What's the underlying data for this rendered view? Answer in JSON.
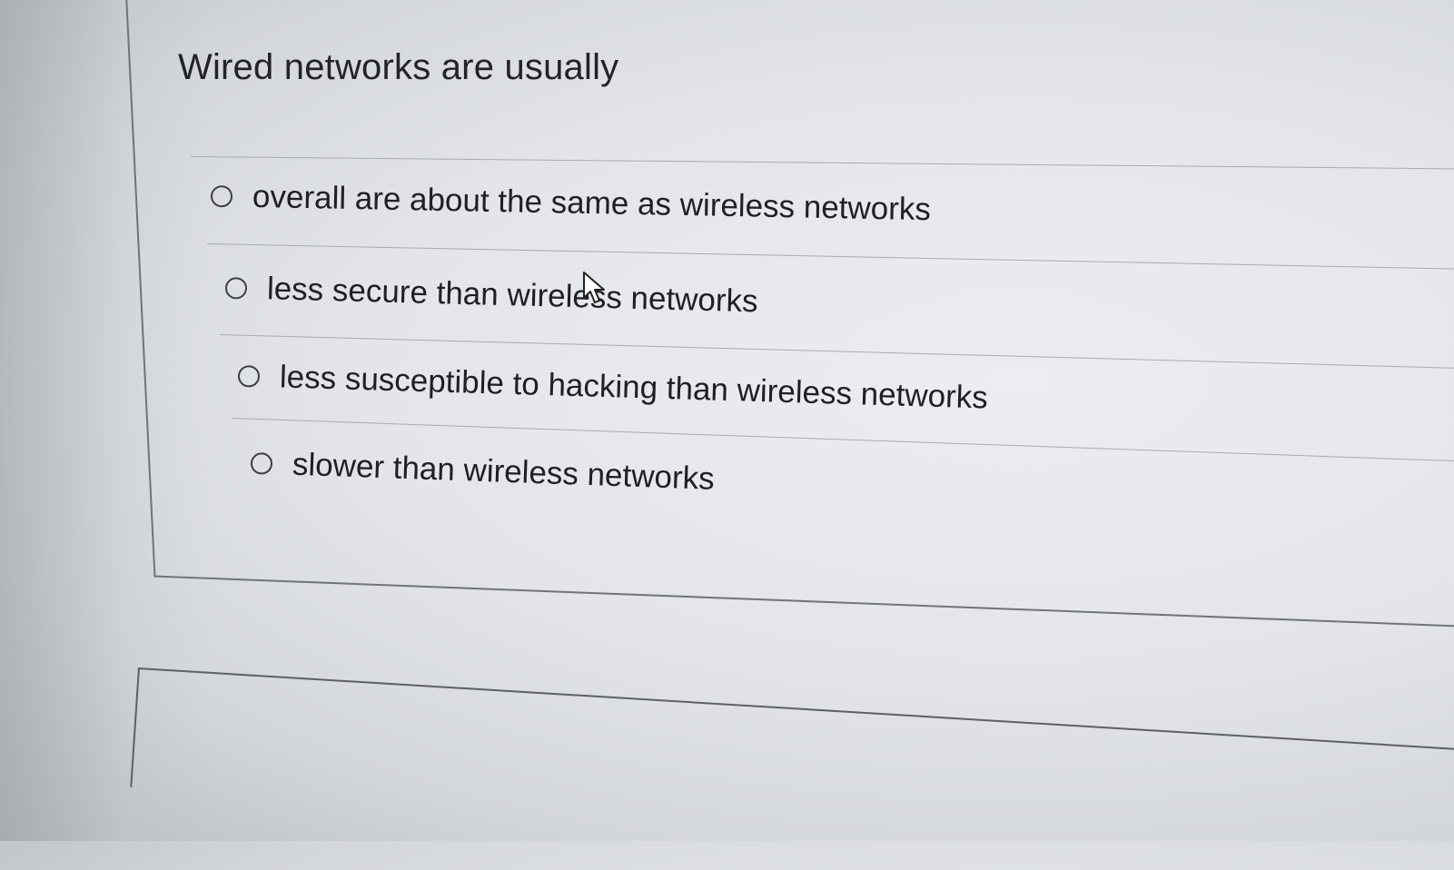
{
  "question": {
    "text": "Wired networks are usually"
  },
  "options": [
    {
      "label": "overall are about the same as wireless networks",
      "selected": false
    },
    {
      "label": "less secure than wireless networks",
      "selected": false
    },
    {
      "label": "less susceptible to hacking than wireless networks",
      "selected": false
    },
    {
      "label": "slower than wireless networks",
      "selected": false
    }
  ],
  "icons": {
    "radio": "radio-empty-icon",
    "cursor": "arrow-pointer-icon"
  }
}
